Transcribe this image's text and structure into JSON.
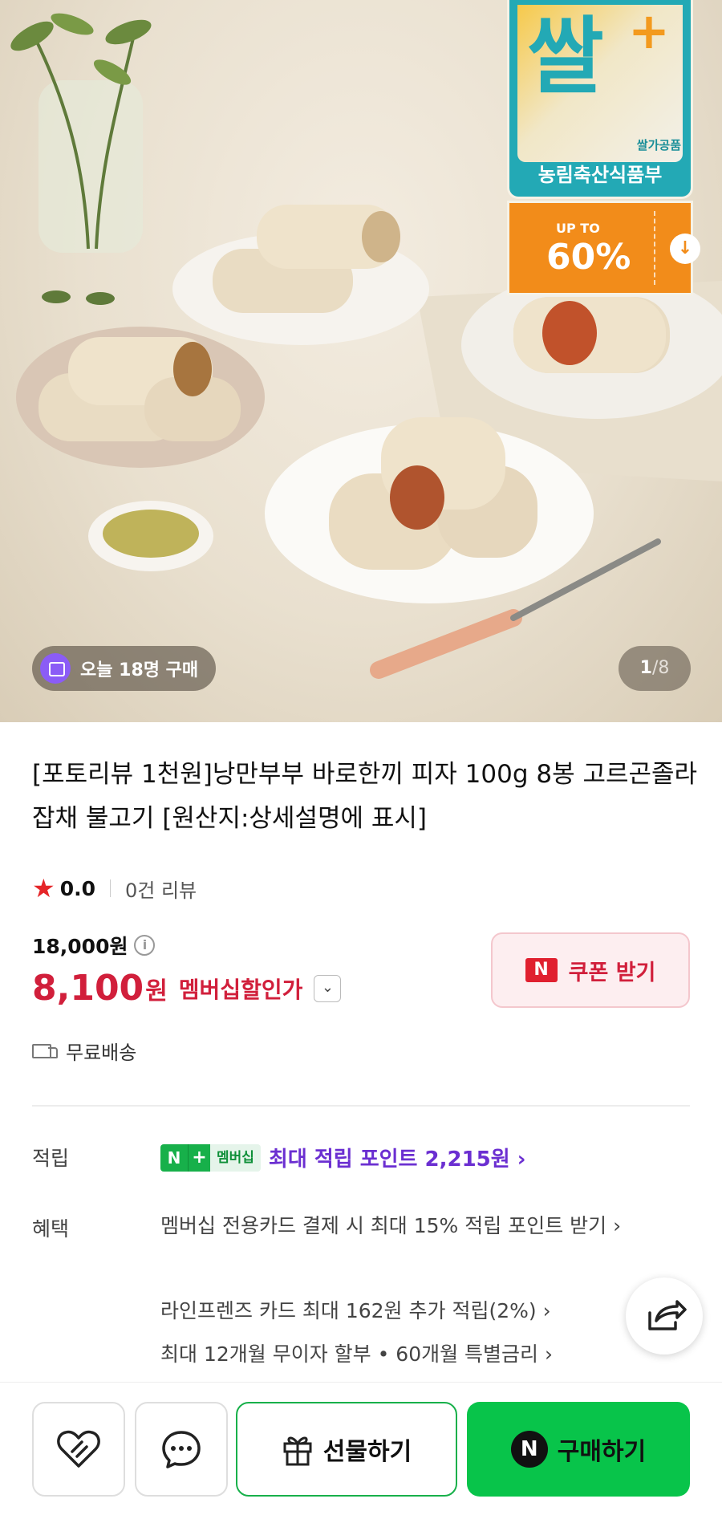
{
  "hero": {
    "rice_badge": {
      "logo": "쌀",
      "plus": "+",
      "sub": "쌀가공품",
      "ministry": "농림축산식품부"
    },
    "promo": {
      "up_to": "UP TO",
      "percent": "60%",
      "download_icon": "download-icon"
    },
    "buyers_today": "오늘 18명 구매",
    "image_counter": {
      "current": "1",
      "separator": "/",
      "total": "8"
    }
  },
  "product": {
    "title": "[포토리뷰 1천원]낭만부부 바로한끼 피자 100g 8봉 고르곤졸라 잡채 불고기 [원산지:상세설명에 표시]",
    "rating": "0.0",
    "review_count": "0건 리뷰",
    "original_price": "18,000원",
    "sale_price": "8,100",
    "sale_unit": "원",
    "sale_label": "멤버십할인가",
    "coupon_logo": "N",
    "coupon_label": "쿠폰 받기",
    "shipping": "무료배송"
  },
  "details": {
    "points_label": "적립",
    "points_badge": {
      "n": "N",
      "plus": "+",
      "membership": "멤버십"
    },
    "points_text": "최대 적립 포인트 2,215원 ›",
    "benefit_label": "혜택",
    "benefits": [
      "멤버십 전용카드 결제 시 최대 15% 적립 포인트 받기 ›",
      "라인프렌즈 카드 최대 162원 추가 적립(2%) ›",
      "최대 12개월 무이자 할부 • 60개월 특별금리 ›"
    ]
  },
  "bottom_bar": {
    "gift_label": "선물하기",
    "buy_logo": "N",
    "buy_label": "구매하기"
  },
  "colors": {
    "sale_red": "#d11f3b",
    "naver_green": "#08c44a",
    "point_purple": "#6b2fd1",
    "promo_orange": "#f28c1a",
    "rice_teal": "#23a9b5"
  }
}
